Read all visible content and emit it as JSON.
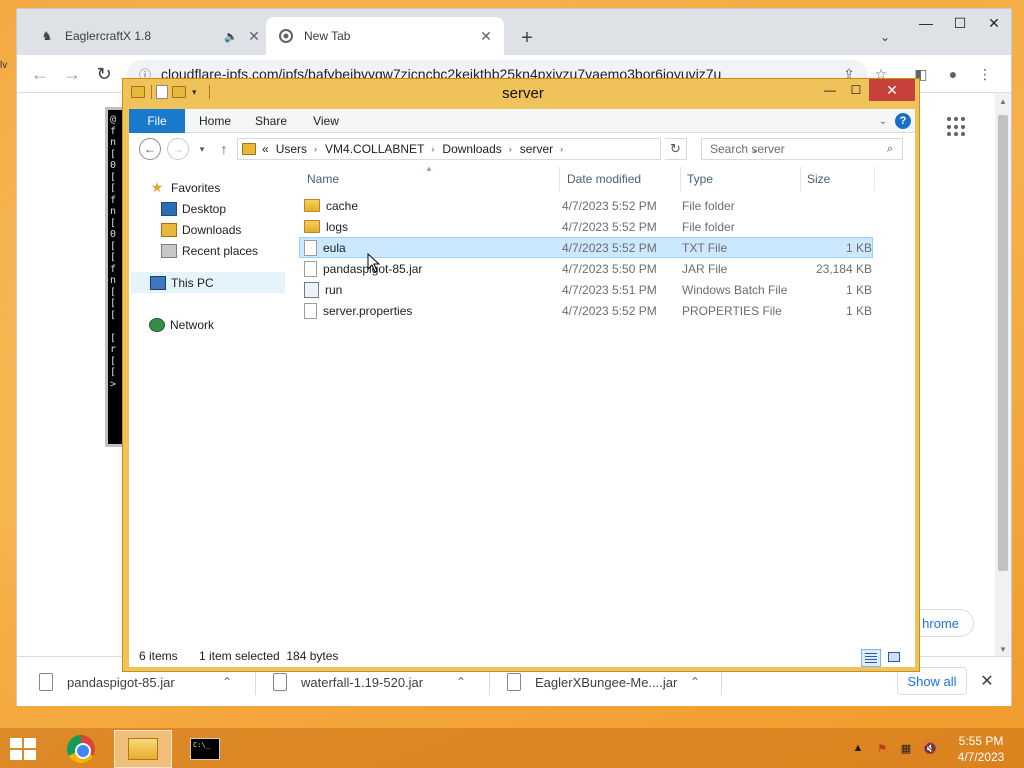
{
  "colors": {
    "desktop": "#f2a23a",
    "explorer_frame": "#f0c25a",
    "ribbon_file_tab": "#1979ca",
    "selection": "#cce8ff",
    "close_button": "#c7413b",
    "chrome_link": "#1a73e8"
  },
  "desktop": {
    "edge_text": "lv"
  },
  "chrome": {
    "tabs": [
      {
        "title": "EaglercraftX 1.8",
        "favicon": "eaglercraft-icon",
        "audio": true
      },
      {
        "title": "New Tab",
        "favicon": "chrome-icon",
        "audio": false
      }
    ],
    "new_tab_symbol": "+",
    "url": "cloudflare-ipfs.com/ipfs/bafybeibvyqw7zjcncbc2keikthb25kn4pxivzu7vaemo3bor6ioyuvjz7u",
    "customize_label": "hrome",
    "terminal_glyphs": "@\nf\nn\n[\n0\n[\n[\nf\nn\n[\n0\n[\n[\nf\nn\n[\n[\n[\n\n[\nr\n[\n[\n>"
  },
  "downloads": {
    "items": [
      {
        "name": "pandaspigot-85.jar"
      },
      {
        "name": "waterfall-1.19-520.jar"
      },
      {
        "name": "EaglerXBungee-Me....jar"
      }
    ],
    "show_all": "Show all",
    "close_symbol": "✕"
  },
  "explorer": {
    "title": "server",
    "ribbon_tabs": {
      "file": "File",
      "home": "Home",
      "share": "Share",
      "view": "View"
    },
    "help_symbol": "?",
    "address": {
      "overflow": "«",
      "segments": [
        "Users",
        "VM4.COLLABNET",
        "Downloads",
        "server"
      ]
    },
    "search_placeholder": "Search server",
    "nav": {
      "favorites": "Favorites",
      "desktop": "Desktop",
      "downloads": "Downloads",
      "recent": "Recent places",
      "this_pc": "This PC",
      "network": "Network"
    },
    "columns": {
      "name": "Name",
      "date": "Date modified",
      "type": "Type",
      "size": "Size"
    },
    "files": [
      {
        "name": "cache",
        "date": "4/7/2023 5:52 PM",
        "type": "File folder",
        "size": "",
        "icon": "folder-icon"
      },
      {
        "name": "logs",
        "date": "4/7/2023 5:52 PM",
        "type": "File folder",
        "size": "",
        "icon": "folder-icon"
      },
      {
        "name": "eula",
        "date": "4/7/2023 5:52 PM",
        "type": "TXT File",
        "size": "1 KB",
        "icon": "text-file-icon",
        "selected": true
      },
      {
        "name": "pandaspigot-85.jar",
        "date": "4/7/2023 5:50 PM",
        "type": "JAR File",
        "size": "23,184 KB",
        "icon": "jar-file-icon"
      },
      {
        "name": "run",
        "date": "4/7/2023 5:51 PM",
        "type": "Windows Batch File",
        "size": "1 KB",
        "icon": "batch-file-icon"
      },
      {
        "name": "server.properties",
        "date": "4/7/2023 5:52 PM",
        "type": "PROPERTIES File",
        "size": "1 KB",
        "icon": "properties-file-icon"
      }
    ],
    "status": {
      "count": "6 items",
      "selection": "1 item selected  184 bytes"
    }
  },
  "taskbar": {
    "time": "5:55 PM",
    "date": "4/7/2023"
  }
}
